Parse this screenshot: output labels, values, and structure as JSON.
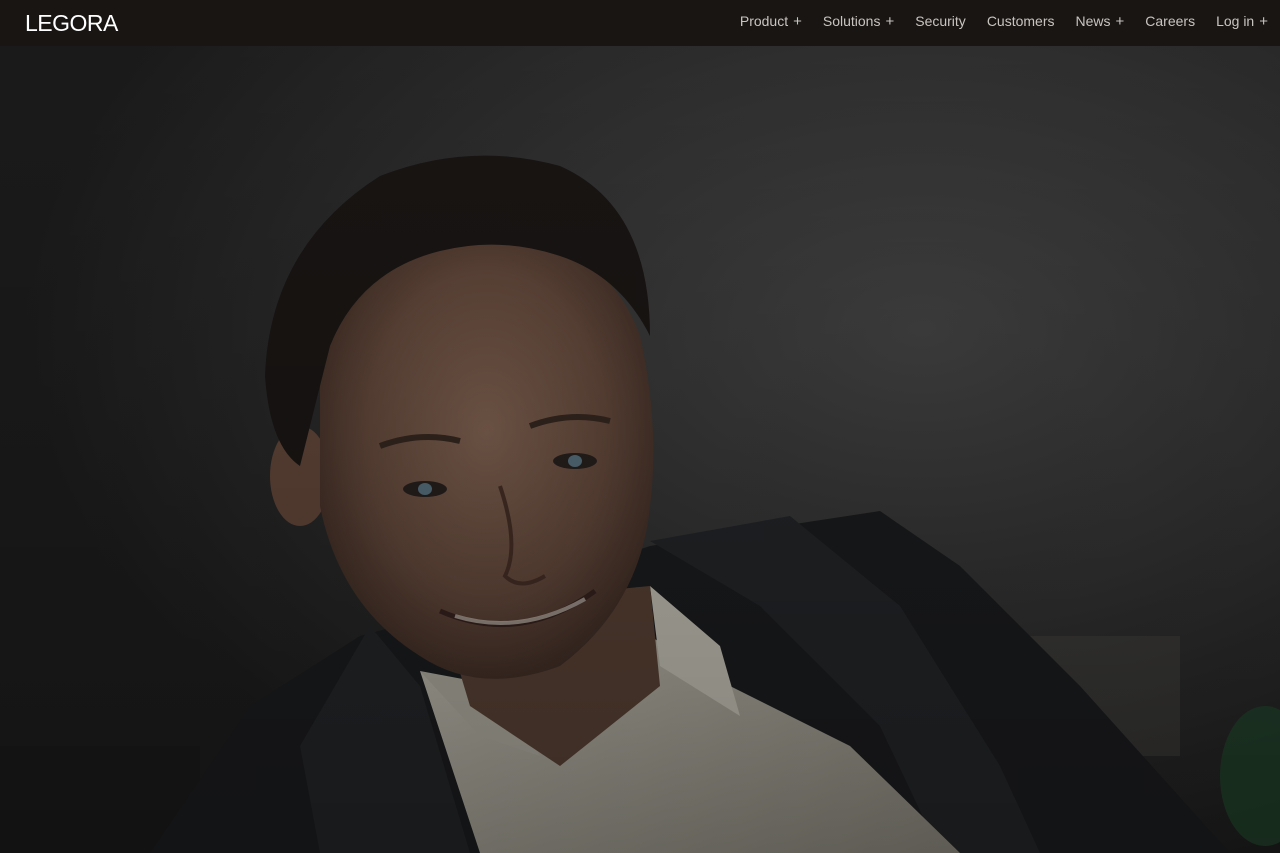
{
  "brand": {
    "logo_text": "LEGORA"
  },
  "nav": {
    "items": [
      {
        "label": "Product",
        "has_plus": true
      },
      {
        "label": "Solutions",
        "has_plus": true
      },
      {
        "label": "Security",
        "has_plus": false
      },
      {
        "label": "Customers",
        "has_plus": false
      },
      {
        "label": "News",
        "has_plus": true
      },
      {
        "label": "Careers",
        "has_plus": false
      },
      {
        "label": "Log in",
        "has_plus": true
      }
    ],
    "expand_icon": "plus-icon"
  },
  "hero": {
    "image": "portrait-photo",
    "subject": "smiling man in dark blazer and white shirt",
    "colors": {
      "background": "#3a3a3a",
      "navbar": "#181513"
    }
  }
}
